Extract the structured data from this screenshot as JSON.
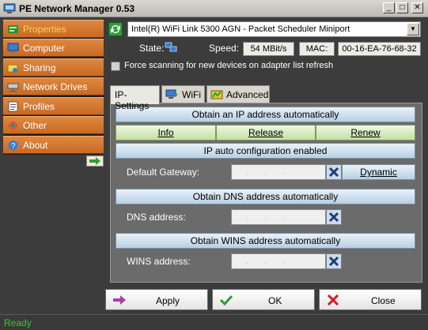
{
  "window": {
    "title": "PE Network Manager 0.53",
    "min": "_",
    "max": "□",
    "close": "✕"
  },
  "sidebar": {
    "items": [
      {
        "label": "Properties",
        "icon": "properties-icon"
      },
      {
        "label": "Computer",
        "icon": "computer-icon"
      },
      {
        "label": "Sharing",
        "icon": "sharing-icon"
      },
      {
        "label": "Network Drives",
        "icon": "network-drives-icon"
      },
      {
        "label": "Profiles",
        "icon": "profiles-icon"
      },
      {
        "label": "Other",
        "icon": "other-icon"
      },
      {
        "label": "About",
        "icon": "about-icon"
      }
    ],
    "active_index": 0
  },
  "adapter": {
    "selected": "Intel(R) WiFi Link 5300 AGN - Packet Scheduler Miniport"
  },
  "info": {
    "state_label": "State:",
    "speed_label": "Speed:",
    "speed_value": "54 MBit/s",
    "mac_label": "MAC:",
    "mac_value": "00-16-EA-76-68-32"
  },
  "force_scan": {
    "label": "Force scanning for new devices on adapter list refresh",
    "checked": false
  },
  "tabs": [
    {
      "label": "IP-Settings",
      "active": true
    },
    {
      "label": "WiFi",
      "active": false
    },
    {
      "label": "Advanced",
      "active": false
    }
  ],
  "ip": {
    "obtain_ip": "Obtain an IP address automatically",
    "info_btn": "Info",
    "release_btn": "Release",
    "renew_btn": "Renew",
    "auto_config": "IP auto configuration enabled",
    "gateway_label": "Default Gateway:",
    "dynamic_btn": "Dynamic",
    "obtain_dns": "Obtain DNS address automatically",
    "dns_label": "DNS address:",
    "obtain_wins": "Obtain WINS address automatically",
    "wins_label": "WINS address:",
    "ip_placeholder": ". . ."
  },
  "footer": {
    "apply": "Apply",
    "ok": "OK",
    "close": "Close"
  },
  "status": {
    "text": "Ready"
  },
  "colors": {
    "accent_orange": "#c66a24",
    "status_green": "#2bd12b",
    "bar_blue": "#b7cfe3",
    "btn_green": "#c4dfa2"
  }
}
